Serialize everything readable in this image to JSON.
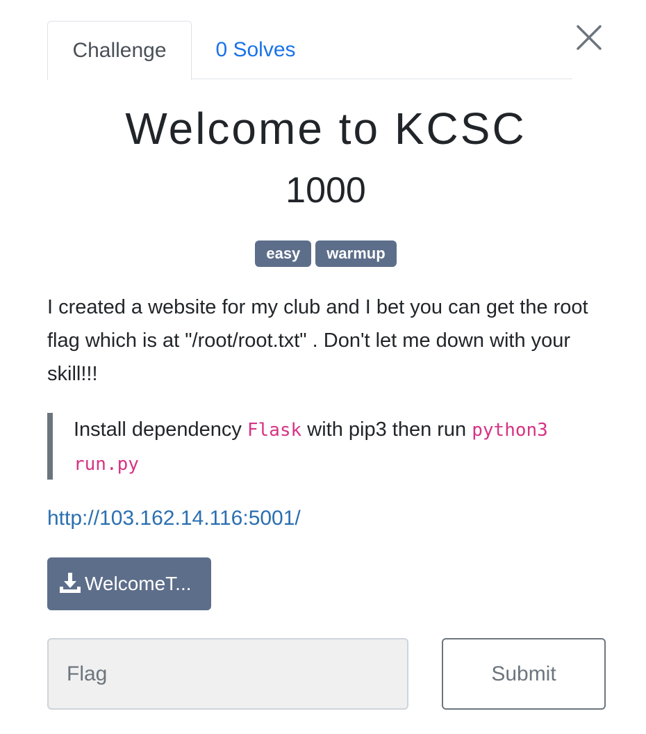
{
  "tabs": [
    {
      "label": "Challenge",
      "active": true
    },
    {
      "label": "0 Solves",
      "active": false
    }
  ],
  "close": {
    "icon": "close-icon"
  },
  "challenge": {
    "title": "Welcome to KCSC",
    "points": "1000",
    "tags": [
      "easy",
      "warmup"
    ],
    "description": "I created a website for my club and I bet you can get the root flag which is at \"/root/root.txt\" . Don't let me down with your skill!!!",
    "note": {
      "text_before": "Install dependency ",
      "code1": "Flask",
      "text_middle": " with pip3 then run ",
      "code2": "python3 run.py"
    },
    "link": "http://103.162.14.116:5001/",
    "file_button": {
      "label": "WelcomeT...",
      "icon": "download-icon"
    }
  },
  "form": {
    "flag_placeholder": "Flag",
    "submit_label": "Submit"
  },
  "colors": {
    "badge": "#5d6e8a",
    "tab_link": "#1a73e8",
    "code": "#d63384",
    "link": "#2a6fb0"
  }
}
